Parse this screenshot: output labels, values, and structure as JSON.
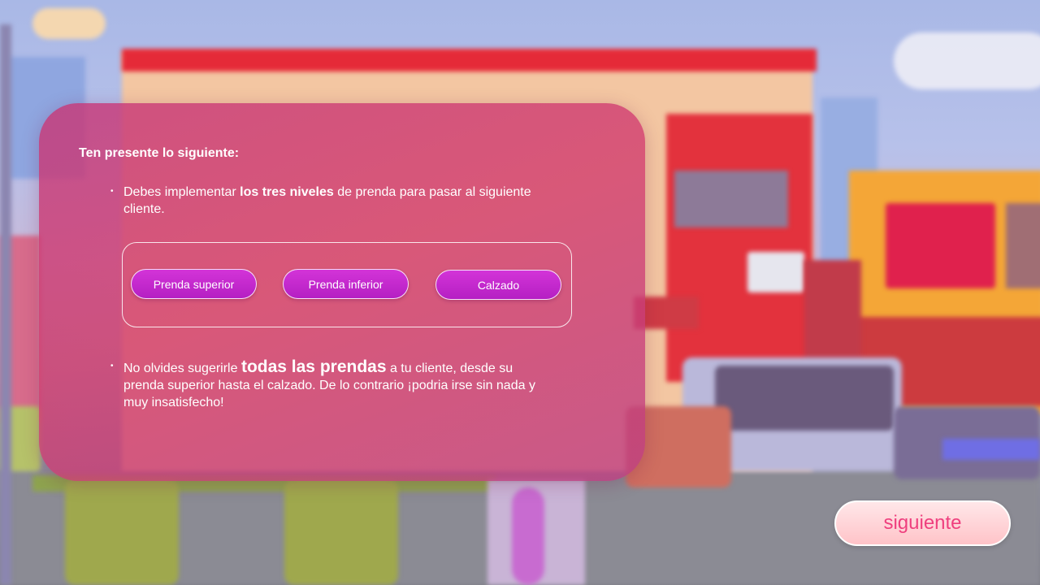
{
  "card": {
    "title": "Ten presente lo siguiente:",
    "bullet_symbol": "•",
    "bullet1": {
      "before": "Debes implementar ",
      "bold": "los tres niveles",
      "after": " de prenda para pasar al siguiente cliente."
    },
    "levels": [
      {
        "label": "Prenda superior"
      },
      {
        "label": "Prenda inferior"
      },
      {
        "label": "Calzado"
      }
    ],
    "bullet2": {
      "before": "No olvides sugerirle ",
      "bold": "todas las prendas",
      "after": " a tu cliente, desde su prenda superior hasta el calzado. De lo contrario ¡podria irse sin nada y muy insatisfecho!"
    }
  },
  "next_button": {
    "label": "siguiente"
  },
  "colors": {
    "card": "#c6377a",
    "level_button": "#c42acd",
    "next_button_bg": "#ffd6da",
    "next_button_text": "#ef3f7e"
  }
}
